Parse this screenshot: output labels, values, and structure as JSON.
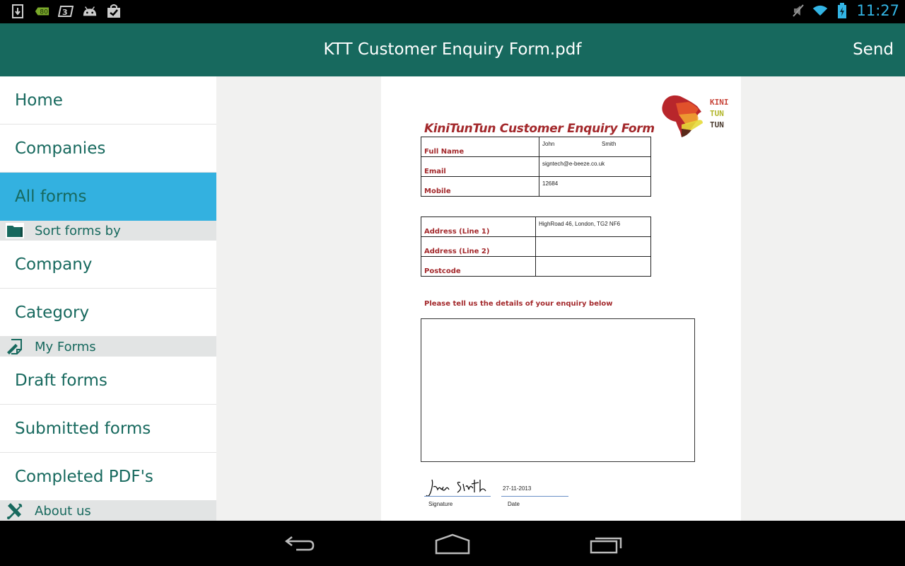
{
  "status_bar": {
    "left_icons": [
      "download-icon",
      "battery-80-badge-icon",
      "sim-3-icon",
      "android-icon",
      "store-bag-check-icon"
    ],
    "battery_badge": "80",
    "right_icons": [
      "mute-icon",
      "wifi-icon",
      "battery-charging-icon"
    ],
    "time": "11:27"
  },
  "action_bar": {
    "title": "KTT Customer Enquiry Form.pdf",
    "send_label": "Send",
    "color": "#17695e"
  },
  "sidebar": {
    "items": [
      {
        "type": "item",
        "label": "Home",
        "active": false
      },
      {
        "type": "item",
        "label": "Companies",
        "active": false
      },
      {
        "type": "item",
        "label": "All forms",
        "active": true
      },
      {
        "type": "header",
        "label": "Sort forms by",
        "icon": "folder-icon"
      },
      {
        "type": "item",
        "label": "Company",
        "active": false
      },
      {
        "type": "item",
        "label": "Category",
        "active": false
      },
      {
        "type": "header",
        "label": "My Forms",
        "icon": "edit-form-icon"
      },
      {
        "type": "item",
        "label": "Draft forms",
        "active": false
      },
      {
        "type": "item",
        "label": "Submitted forms",
        "active": false
      },
      {
        "type": "item",
        "label": "Completed PDF's",
        "active": false
      },
      {
        "type": "header",
        "label": "About us",
        "icon": "tools-icon"
      }
    ],
    "active_color": "#33b1e0"
  },
  "document": {
    "form_title": "KiniTunTun Customer Enquiry Form",
    "logo_lines": [
      "KINI",
      "TUN",
      "TUN"
    ],
    "contact_table": [
      {
        "label": "Full Name",
        "value_first": "John",
        "value_last": "Smith"
      },
      {
        "label": "Email",
        "value": "signtech@e-beeze.co.uk"
      },
      {
        "label": "Mobile",
        "value": "12684"
      }
    ],
    "address_table": [
      {
        "label": "Address (Line 1)",
        "value": "HighRoad 46, London, TG2 NF6"
      },
      {
        "label": "Address (Line 2)",
        "value": ""
      },
      {
        "label": "Postcode",
        "value": ""
      }
    ],
    "enquiry_label": "Please tell us the details of your enquiry below",
    "enquiry_text": "",
    "signature_label": "Signature",
    "date_label": "Date",
    "date_value": "27-11-2013"
  },
  "nav_bar": {
    "buttons": [
      "back-icon",
      "home-icon",
      "recents-icon"
    ]
  }
}
